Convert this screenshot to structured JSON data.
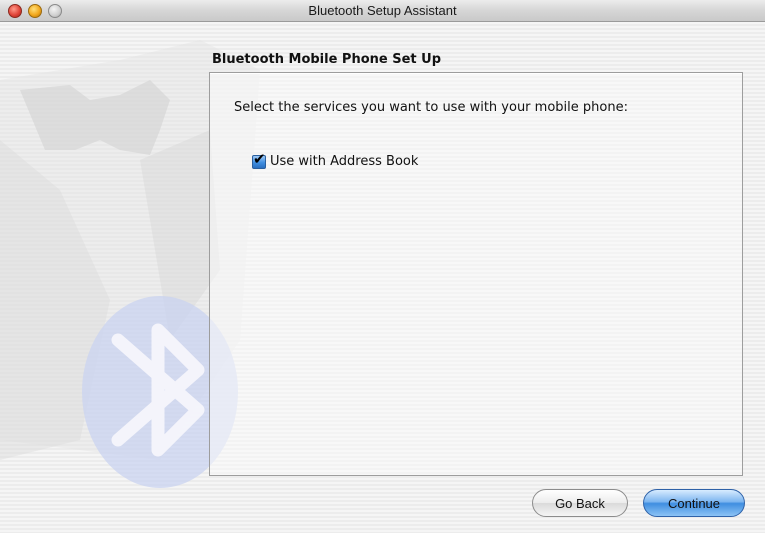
{
  "window": {
    "title": "Bluetooth Setup Assistant"
  },
  "main": {
    "heading": "Bluetooth Mobile Phone Set Up",
    "prompt": "Select the services you want to use with your mobile phone:",
    "options": [
      {
        "label": "Use with Address Book",
        "checked": true
      }
    ]
  },
  "buttons": {
    "back_label": "Go Back",
    "continue_label": "Continue"
  },
  "colors": {
    "accent": "#3f8ee0",
    "close": "#e0463a",
    "minimize": "#f2a81d"
  }
}
